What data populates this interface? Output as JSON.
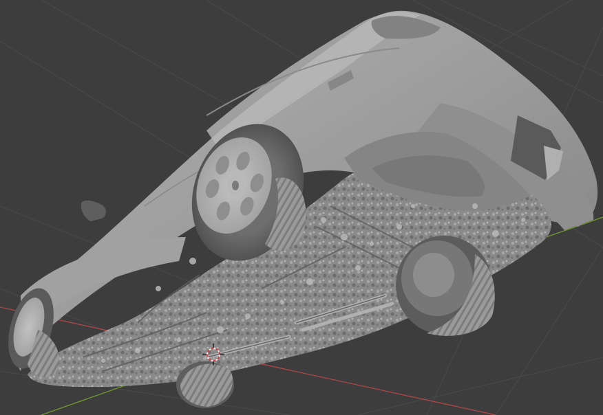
{
  "viewport": {
    "mode": "3D viewport",
    "shading": "solid",
    "background_color": "#3d3d3d",
    "grid_line_color": "#4a4a4a",
    "x_axis_color": "#b04848",
    "y_axis_color": "#6f9a2e",
    "cursor_icon": "3d-cursor-icon"
  },
  "model": {
    "subject": "car-underside-scan",
    "base_color": "#9a9a9a"
  }
}
